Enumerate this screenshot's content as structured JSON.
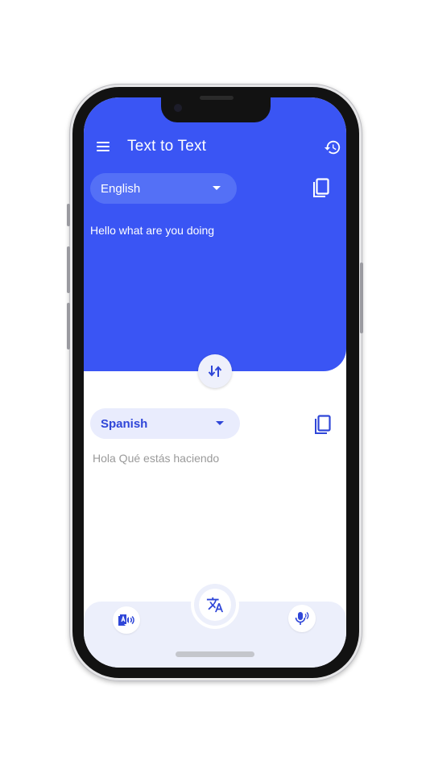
{
  "header": {
    "title": "Text to Text",
    "menu_icon": "menu-icon",
    "history_icon": "history-icon"
  },
  "source": {
    "language": "English",
    "text": "Hello what are you doing",
    "copy_icon": "copy-icon"
  },
  "target": {
    "language": "Spanish",
    "text": "Hola Qué estás haciendo",
    "copy_icon": "copy-icon"
  },
  "swap_icon": "swap-vertical-icon",
  "bottom_nav": {
    "left_icon": "text-to-speech-icon",
    "center_icon": "translate-icon",
    "right_icon": "voice-input-icon"
  },
  "colors": {
    "primary": "#3a55f4",
    "pill_light": "#e9ecfd",
    "accent_text": "#2f46d8",
    "nav_background": "#eceffb"
  }
}
